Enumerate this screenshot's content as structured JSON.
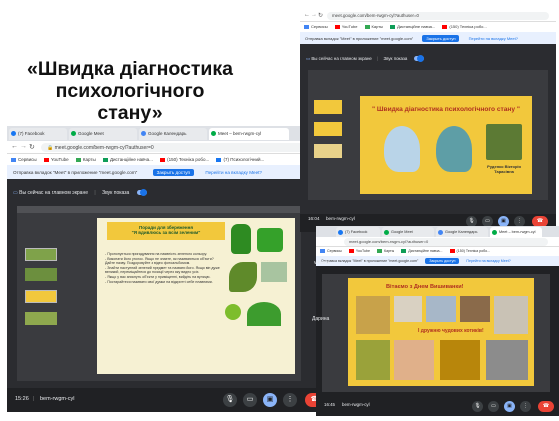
{
  "title": {
    "line1": "«Швидка діагностика",
    "line2": "психологічного",
    "line3": "стану»"
  },
  "browser": {
    "tabs": [
      "(7) Facebook",
      "Google Meet",
      "Google Календарь",
      "Meet – bem-rwgm-cyl"
    ],
    "url": "meet.google.com/bem-rwgm-cyl?authuser=0",
    "url_short": "meet.google.com/bem-rwgm-cyl?authuser=0",
    "bookmarks": [
      "Сервисы",
      "YouTube",
      "Карты",
      "Дистанційне навча...",
      "(150) Техніка робо...",
      "(7) Психологічний..."
    ],
    "notification": "Отправка вкладок \"Meet\" в приложение \"meet.google.com\"",
    "notification_btn": "Закрыть доступ",
    "notification_link": "Перейти на вкладку Meet?",
    "main_screen_label": "Вы сейчас на главном экране",
    "sound_label": "Звук показа"
  },
  "main_window": {
    "slide_header": "Поради для збереження",
    "slide_subheader": "\"Я вдивлюсь за всім зеленим\"",
    "bullets": [
      "- Пропонується пригадування на наявність зеленого кольору.",
      "- Виконати його уголос. Якщо не знаєте, як називаються об'єкти? Дайте назву. Поздоровуйте з відео фотоальбомом.",
      "- Знайти наступний зелений предмет та назвати його. Якщо він дуже великий, переміщайтеся до позиції через яку видно усіх.",
      "- Якщо у вас зникнуть об'єкти у приміщенні, вийдіть на вулицю.",
      "- Постарайтеся називати свої думки на відкритті себе плавними."
    ],
    "time": "15:26",
    "meeting_code": "bem-rwgm-cyl"
  },
  "top_right_window": {
    "slide_title": "\" Швидка діагностика психологічного стану \"",
    "author_line1": "Руденко Вікторія",
    "author_line2": "Тарасівна",
    "time": "16:04",
    "meeting_code": "bem-rwgm-cyl"
  },
  "bottom_right_window": {
    "slide_line1": "Вітаємо з Днем Вишиванки!",
    "slide_line2": "І дружню чудових котиків!",
    "time": "16:45",
    "meeting_code": "bem-rwgm-cyl"
  },
  "side_labels": {
    "viktoria": "viktoria",
    "darina1": "Дарина",
    "darina2": "Дарина"
  },
  "colors": {
    "meet_dark": "#202124",
    "slide_yellow": "#f2c83c",
    "end_call": "#ea4335",
    "accent_blue": "#1a73e8"
  }
}
